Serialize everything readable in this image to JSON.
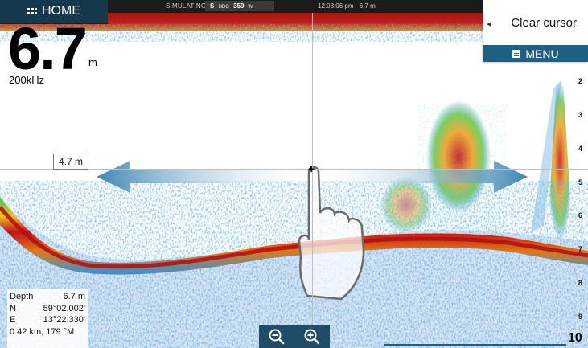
{
  "status": {
    "simulating": "SIMULATING...",
    "hdg_prefix": "S",
    "hdg_label": "HDG",
    "hdg_value": "359",
    "hdg_unit": "°M",
    "time": "12:08:06 pm",
    "depth_short": "6.7 m"
  },
  "home_button": {
    "label": "HOME"
  },
  "depth_readout": {
    "value": "6.7",
    "unit": "m",
    "frequency": "200kHz"
  },
  "context_menu": {
    "clear_cursor": "Clear cursor",
    "menu_label": "MENU"
  },
  "depth_scale": [
    "2",
    "3",
    "4",
    "5",
    "6",
    "7",
    "8",
    "9",
    "10"
  ],
  "cursor": {
    "depth_label": "4.7 m"
  },
  "info": {
    "depth_label": "Depth",
    "depth_value": "6.7  m",
    "lat_label": "N",
    "lat_value": "59°02.002'",
    "lon_label": "E",
    "lon_value": "13°22.330'",
    "range_bearing": "0.42 km, 179 °M"
  },
  "colors": {
    "accent": "#1f5f83",
    "home_bg": "#16384c",
    "arrow": "#3f86b4",
    "sonar_red": "#c0141a",
    "sonar_blue": "#2f6fb4"
  },
  "icons": [
    "grid-icon",
    "menu-icon",
    "zoom-out-icon",
    "zoom-in-icon",
    "hand-pointer-icon",
    "cursor-crosshair-icon",
    "left-arrow-icon",
    "right-arrow-icon"
  ]
}
